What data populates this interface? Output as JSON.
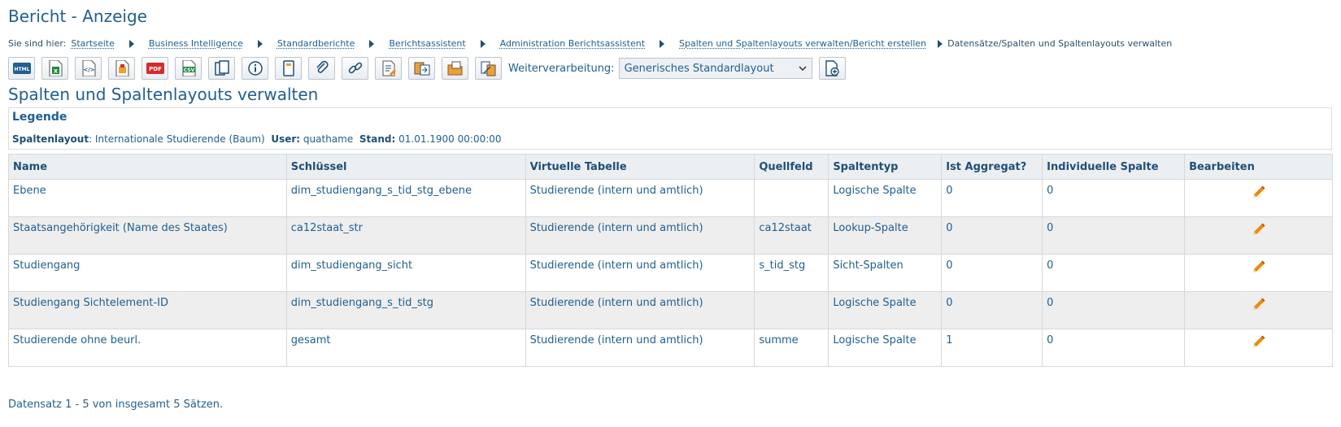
{
  "page": {
    "title": "Bericht - Anzeige"
  },
  "breadcrumb": {
    "label": "Sie sind hier:",
    "items": [
      "Startseite",
      "Business Intelligence",
      "Standardberichte",
      "Berichtsassistent",
      "Administration Berichtsassistent",
      "Spalten und Spaltenlayouts verwalten/Bericht erstellen"
    ],
    "current": "Datensätze/Spalten und Spaltenlayouts verwalten"
  },
  "toolbar": {
    "buttons": [
      "html-export",
      "excel-export",
      "xml-export",
      "print",
      "pdf-export",
      "csv-export",
      "copy",
      "info",
      "bookmark",
      "attachment",
      "link",
      "edit-report",
      "export-1",
      "export-2",
      "export-3"
    ],
    "weiterverarbeitung_label": "Weiterverarbeitung:",
    "layout_selected": "Generisches Standardlayout",
    "new_layout": "new-layout"
  },
  "section": {
    "title": "Spalten und Spaltenlayouts verwalten"
  },
  "legend": {
    "title": "Legende",
    "spaltenlayout_label": "Spaltenlayout",
    "spaltenlayout_value": "Internationale Studierende (Baum)",
    "user_label": "User:",
    "user_value": "quathame",
    "stand_label": "Stand:",
    "stand_value": "01.01.1900 00:00:00"
  },
  "table": {
    "headers": [
      "Name",
      "Schlüssel",
      "Virtuelle Tabelle",
      "Quellfeld",
      "Spaltentyp",
      "Ist Aggregat?",
      "Individuelle Spalte",
      "Bearbeiten"
    ],
    "rows": [
      [
        "Ebene",
        "dim_studiengang_s_tid_stg_ebene",
        "Studierende (intern und amtlich)",
        "",
        "Logische Spalte",
        "0",
        "0"
      ],
      [
        "Staatsangehörigkeit (Name des Staates)",
        "ca12staat_str",
        "Studierende (intern und amtlich)",
        "ca12staat",
        "Lookup-Spalte",
        "0",
        "0"
      ],
      [
        "Studiengang",
        "dim_studiengang_sicht",
        "Studierende (intern und amtlich)",
        "s_tid_stg",
        "Sicht-Spalten",
        "0",
        "0"
      ],
      [
        "Studiengang Sichtelement-ID",
        "dim_studiengang_s_tid_stg",
        "Studierende (intern und amtlich)",
        "",
        "Logische Spalte",
        "0",
        "0"
      ],
      [
        "Studierende ohne beurl.",
        "gesamt",
        "Studierende (intern und amtlich)",
        "summe",
        "Logische Spalte",
        "1",
        "0"
      ]
    ]
  },
  "status": "Datensatz 1 - 5 von insgesamt 5 Sätzen.",
  "colors": {
    "accent": "#1f5f93",
    "header_bg": "#eceff2",
    "row_alt": "#eeeeee",
    "pencil": "#f08a00"
  }
}
